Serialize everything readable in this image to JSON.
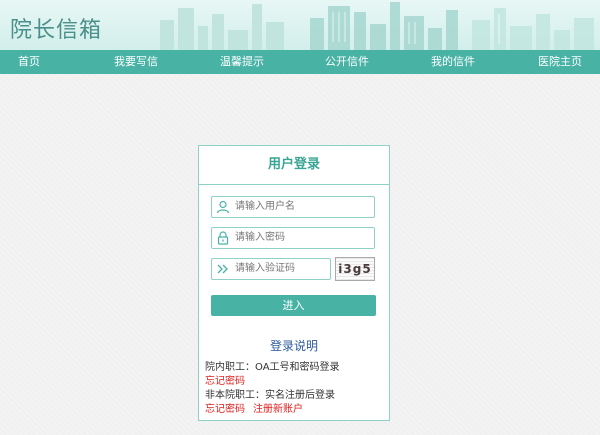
{
  "site": {
    "title": "院长信箱"
  },
  "nav": {
    "items": [
      {
        "label": "首页"
      },
      {
        "label": "我要写信"
      },
      {
        "label": "温馨提示"
      },
      {
        "label": "公开信件"
      },
      {
        "label": "我的信件"
      },
      {
        "label": "医院主页"
      }
    ]
  },
  "login": {
    "title": "用户登录",
    "username_placeholder": "请输入用户名",
    "password_placeholder": "请输入密码",
    "captcha_placeholder": "请输入验证码",
    "captcha_text": "i3g5",
    "submit_label": "进入"
  },
  "help": {
    "title": "登录说明",
    "staff_line": "院内职工：OA工号和密码登录",
    "staff_forgot": "忘记密码",
    "nonstaff_line": "非本院职工：实名注册后登录",
    "nonstaff_forgot": "忘记密码",
    "register": "注册新账户"
  },
  "colors": {
    "accent": "#48b2a5",
    "border": "#8fd0c8",
    "link_red": "#e02020",
    "help_blue": "#2d5a9a"
  },
  "icons": {
    "username": "user-icon",
    "password": "lock-icon",
    "captcha": "double-chevron-right-icon"
  }
}
